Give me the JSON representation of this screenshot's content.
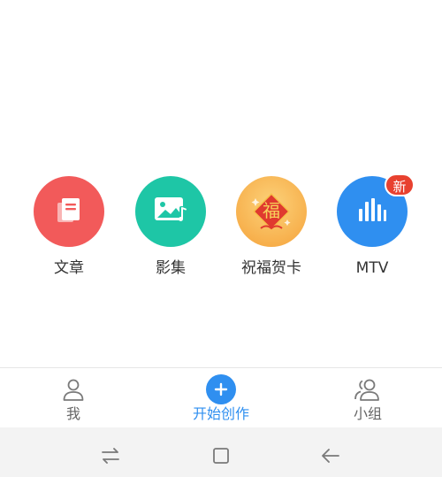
{
  "colors": {
    "article": "#f25a5a",
    "album": "#1ec6a6",
    "card_light": "#fcd27a",
    "card_dark": "#f5a23a",
    "card_red": "#e03a2f",
    "mtv": "#2f8ff0",
    "badge": "#e8412f",
    "accent": "#2f8ff0",
    "tab_text": "#666666",
    "sysnav_icon": "#7a7a7a"
  },
  "options": [
    {
      "label": "文章",
      "icon": "document-icon"
    },
    {
      "label": "影集",
      "icon": "photo-music-icon"
    },
    {
      "label": "祝福贺卡",
      "icon": "fu-card-icon",
      "fu": "福"
    },
    {
      "label": "MTV",
      "icon": "equalizer-icon",
      "badge": "新"
    }
  ],
  "tabbar": {
    "tabs": [
      {
        "label": "我",
        "icon": "person-icon"
      },
      {
        "label": "开始创作",
        "icon": "plus-icon",
        "active": true
      },
      {
        "label": "小组",
        "icon": "group-icon"
      }
    ]
  },
  "sysnav": {
    "icons": [
      "switch-icon",
      "home-square-icon",
      "back-arrow-icon"
    ]
  }
}
